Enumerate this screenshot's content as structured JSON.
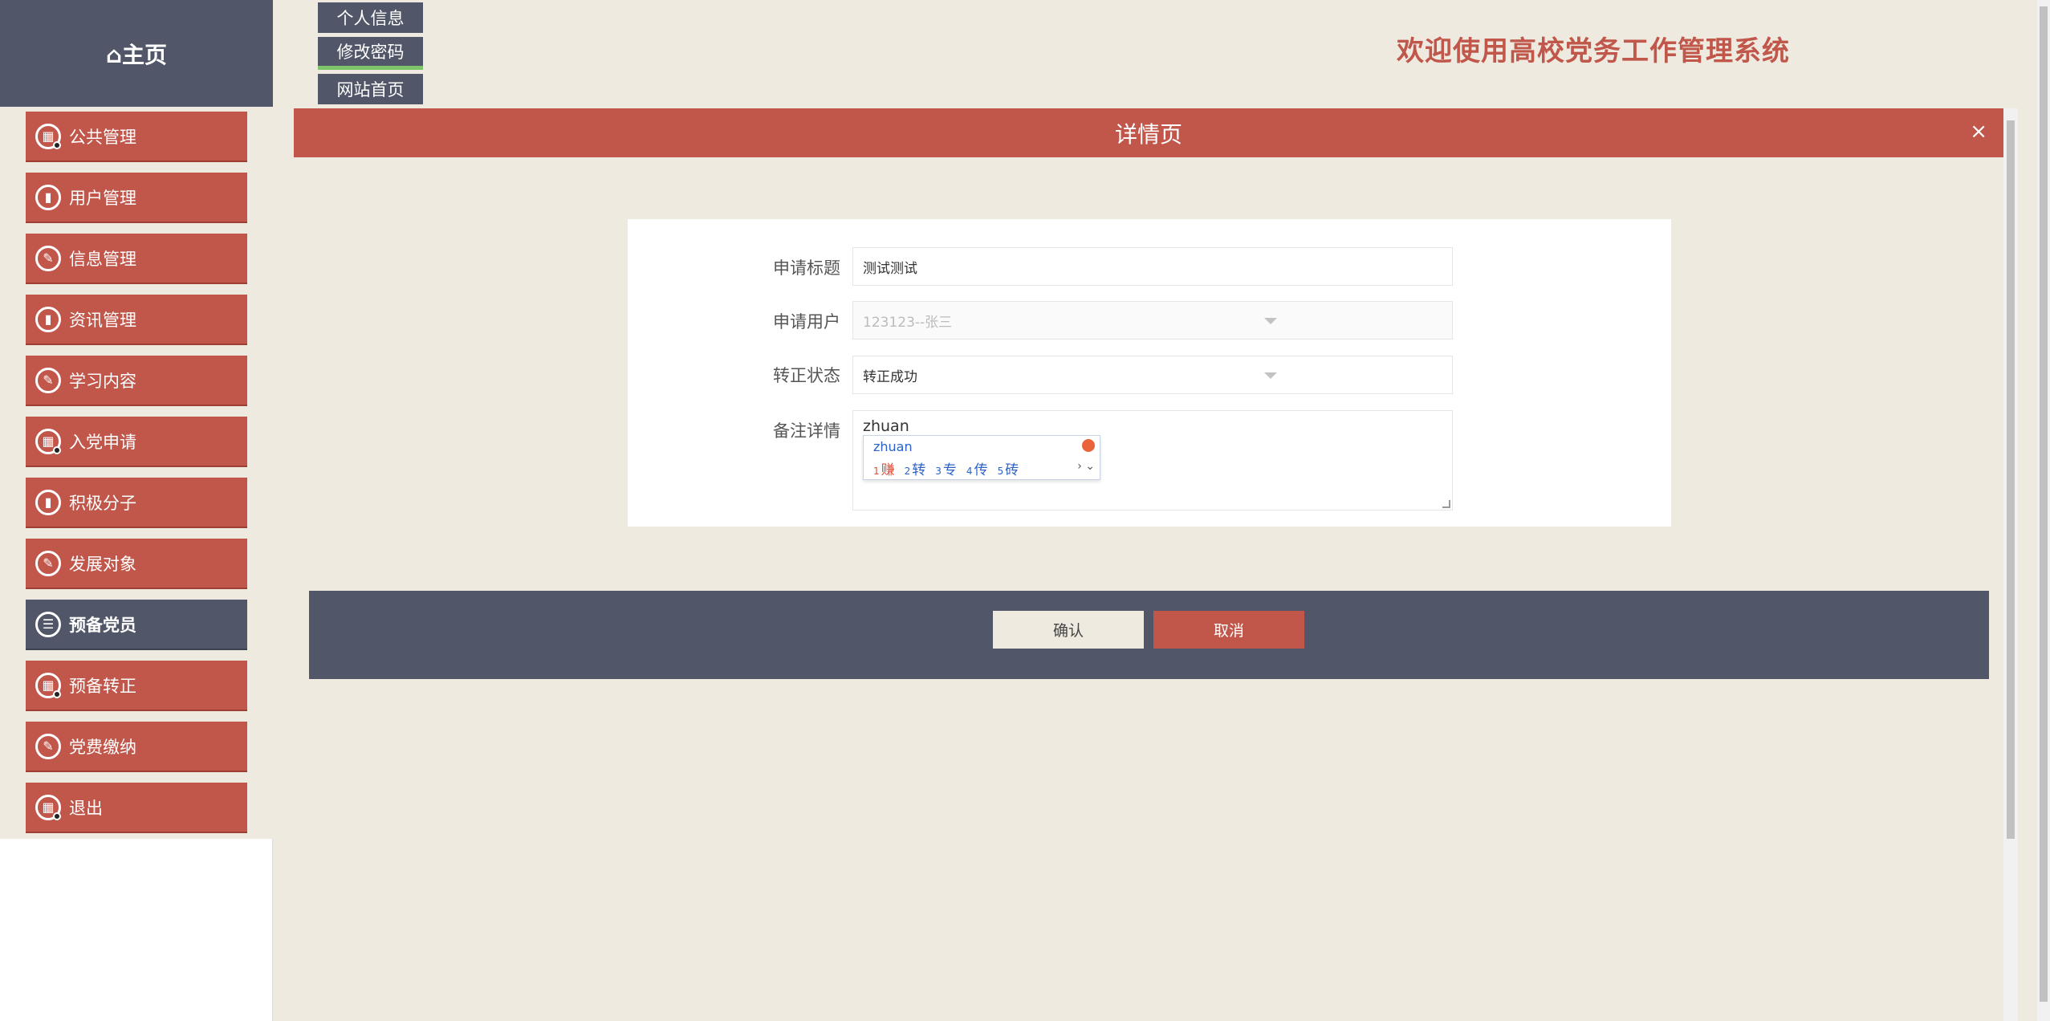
{
  "home": {
    "icon": "home-icon",
    "label": "⌂主页"
  },
  "top_buttons": [
    {
      "label": "个人信息"
    },
    {
      "label": "修改密码"
    },
    {
      "label": "网站首页"
    }
  ],
  "welcome": "欢迎使用高校党务工作管理系统",
  "sidebar": {
    "items": [
      {
        "label": "公共管理",
        "icon": "calendar-icon"
      },
      {
        "label": "用户管理",
        "icon": "chart-icon"
      },
      {
        "label": "信息管理",
        "icon": "edit-icon"
      },
      {
        "label": "资讯管理",
        "icon": "chart-icon"
      },
      {
        "label": "学习内容",
        "icon": "edit-icon"
      },
      {
        "label": "入党申请",
        "icon": "calendar-icon"
      },
      {
        "label": "积极分子",
        "icon": "chart-icon"
      },
      {
        "label": "发展对象",
        "icon": "edit-icon"
      },
      {
        "label": "预备党员",
        "icon": "list-icon",
        "active": true
      },
      {
        "label": "预备转正",
        "icon": "calendar-icon"
      },
      {
        "label": "党费缴纳",
        "icon": "edit-icon"
      },
      {
        "label": "退出",
        "icon": "calendar-icon"
      }
    ]
  },
  "panel": {
    "title": "详情页",
    "close": "×"
  },
  "form": {
    "title_label": "申请标题",
    "title_value": "测试测试",
    "user_label": "申请用户",
    "user_value": "123123--张三",
    "status_label": "转正状态",
    "status_value": "转正成功",
    "remark_label": "备注详情",
    "remark_value": "zhuan"
  },
  "ime": {
    "pinyin": "zhuan",
    "candidates": [
      {
        "n": "1",
        "c": "赚"
      },
      {
        "n": "2",
        "c": "转"
      },
      {
        "n": "3",
        "c": "专"
      },
      {
        "n": "4",
        "c": "传"
      },
      {
        "n": "5",
        "c": "砖"
      }
    ],
    "more": "› ⌄"
  },
  "actions": {
    "confirm": "确认",
    "cancel": "取消"
  }
}
